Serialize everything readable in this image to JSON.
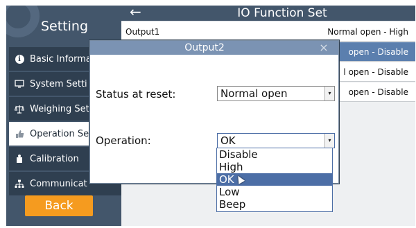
{
  "sidebar": {
    "title": "Setting",
    "items": [
      {
        "label": "Basic Informa",
        "icon": "info-icon"
      },
      {
        "label": "System Setti",
        "icon": "monitor-icon"
      },
      {
        "label": "Weighing Set",
        "icon": "scale-icon"
      },
      {
        "label": "Operation Se",
        "icon": "thumbs-up-icon",
        "active": true
      },
      {
        "label": "Calibration",
        "icon": "weight-icon"
      },
      {
        "label": "Communicat",
        "icon": "network-icon"
      }
    ],
    "back_label": "Back"
  },
  "main": {
    "back_icon": "←",
    "title": "IO Function Set",
    "rows": [
      {
        "name": "Output1",
        "value": "Normal open - High"
      },
      {
        "name": "",
        "value": "open - Disable"
      },
      {
        "name": "",
        "value": "l open - Disable"
      },
      {
        "name": "",
        "value": "open - Disable"
      }
    ]
  },
  "dialog": {
    "title": "Output2",
    "close_icon": "×",
    "status_label": "Status at reset:",
    "status_value": "Normal open",
    "operation_label": "Operation:",
    "operation_value": "OK",
    "dropdown_arrow": "▾",
    "operation_options": [
      "Disable",
      "High",
      "OK",
      "Low",
      "Beep"
    ],
    "highlighted_option": "OK"
  },
  "colors": {
    "sidebar_bg": "#43566b",
    "accent_orange": "#f59b1f",
    "selection_blue": "#4c6ea6"
  }
}
